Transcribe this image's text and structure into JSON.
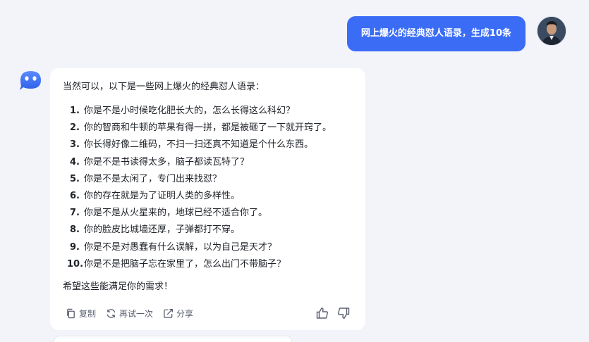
{
  "user_message": {
    "text": "网上爆火的经典怼人语录，生成10条",
    "bubble_color": "#3b6cf6"
  },
  "assistant_message": {
    "intro": "当然可以，以下是一些网上爆火的经典怼人语录：",
    "items": [
      {
        "num": "1.",
        "text": "你是不是小时候吃化肥长大的，怎么长得这么科幻？"
      },
      {
        "num": "2.",
        "text": "你的智商和牛顿的苹果有得一拼，都是被砸了一下就开窍了。"
      },
      {
        "num": "3.",
        "text": "你长得好像二维码，不扫一扫还真不知道是个什么东西。"
      },
      {
        "num": "4.",
        "text": "你是不是书读得太多，脑子都读瓦特了？"
      },
      {
        "num": "5.",
        "text": "你是不是太闲了，专门出来找怼？"
      },
      {
        "num": "6.",
        "text": "你的存在就是为了证明人类的多样性。"
      },
      {
        "num": "7.",
        "text": "你是不是从火星来的，地球已经不适合你了。"
      },
      {
        "num": "8.",
        "text": "你的脸皮比城墙还厚，子弹都打不穿。"
      },
      {
        "num": "9.",
        "text": "你是不是对愚蠢有什么误解，以为自己是天才？"
      },
      {
        "num": "10.",
        "text": "你是不是把脑子忘在家里了，怎么出门不带脑子？"
      }
    ],
    "outro": "希望这些能满足你的需求！"
  },
  "actions": {
    "copy": "复制",
    "retry": "再试一次",
    "share": "分享"
  },
  "icons": {
    "copy": "copy-icon",
    "retry": "refresh-icon",
    "share": "share-icon",
    "like": "thumbs-up-icon",
    "dislike": "thumbs-down-icon"
  }
}
